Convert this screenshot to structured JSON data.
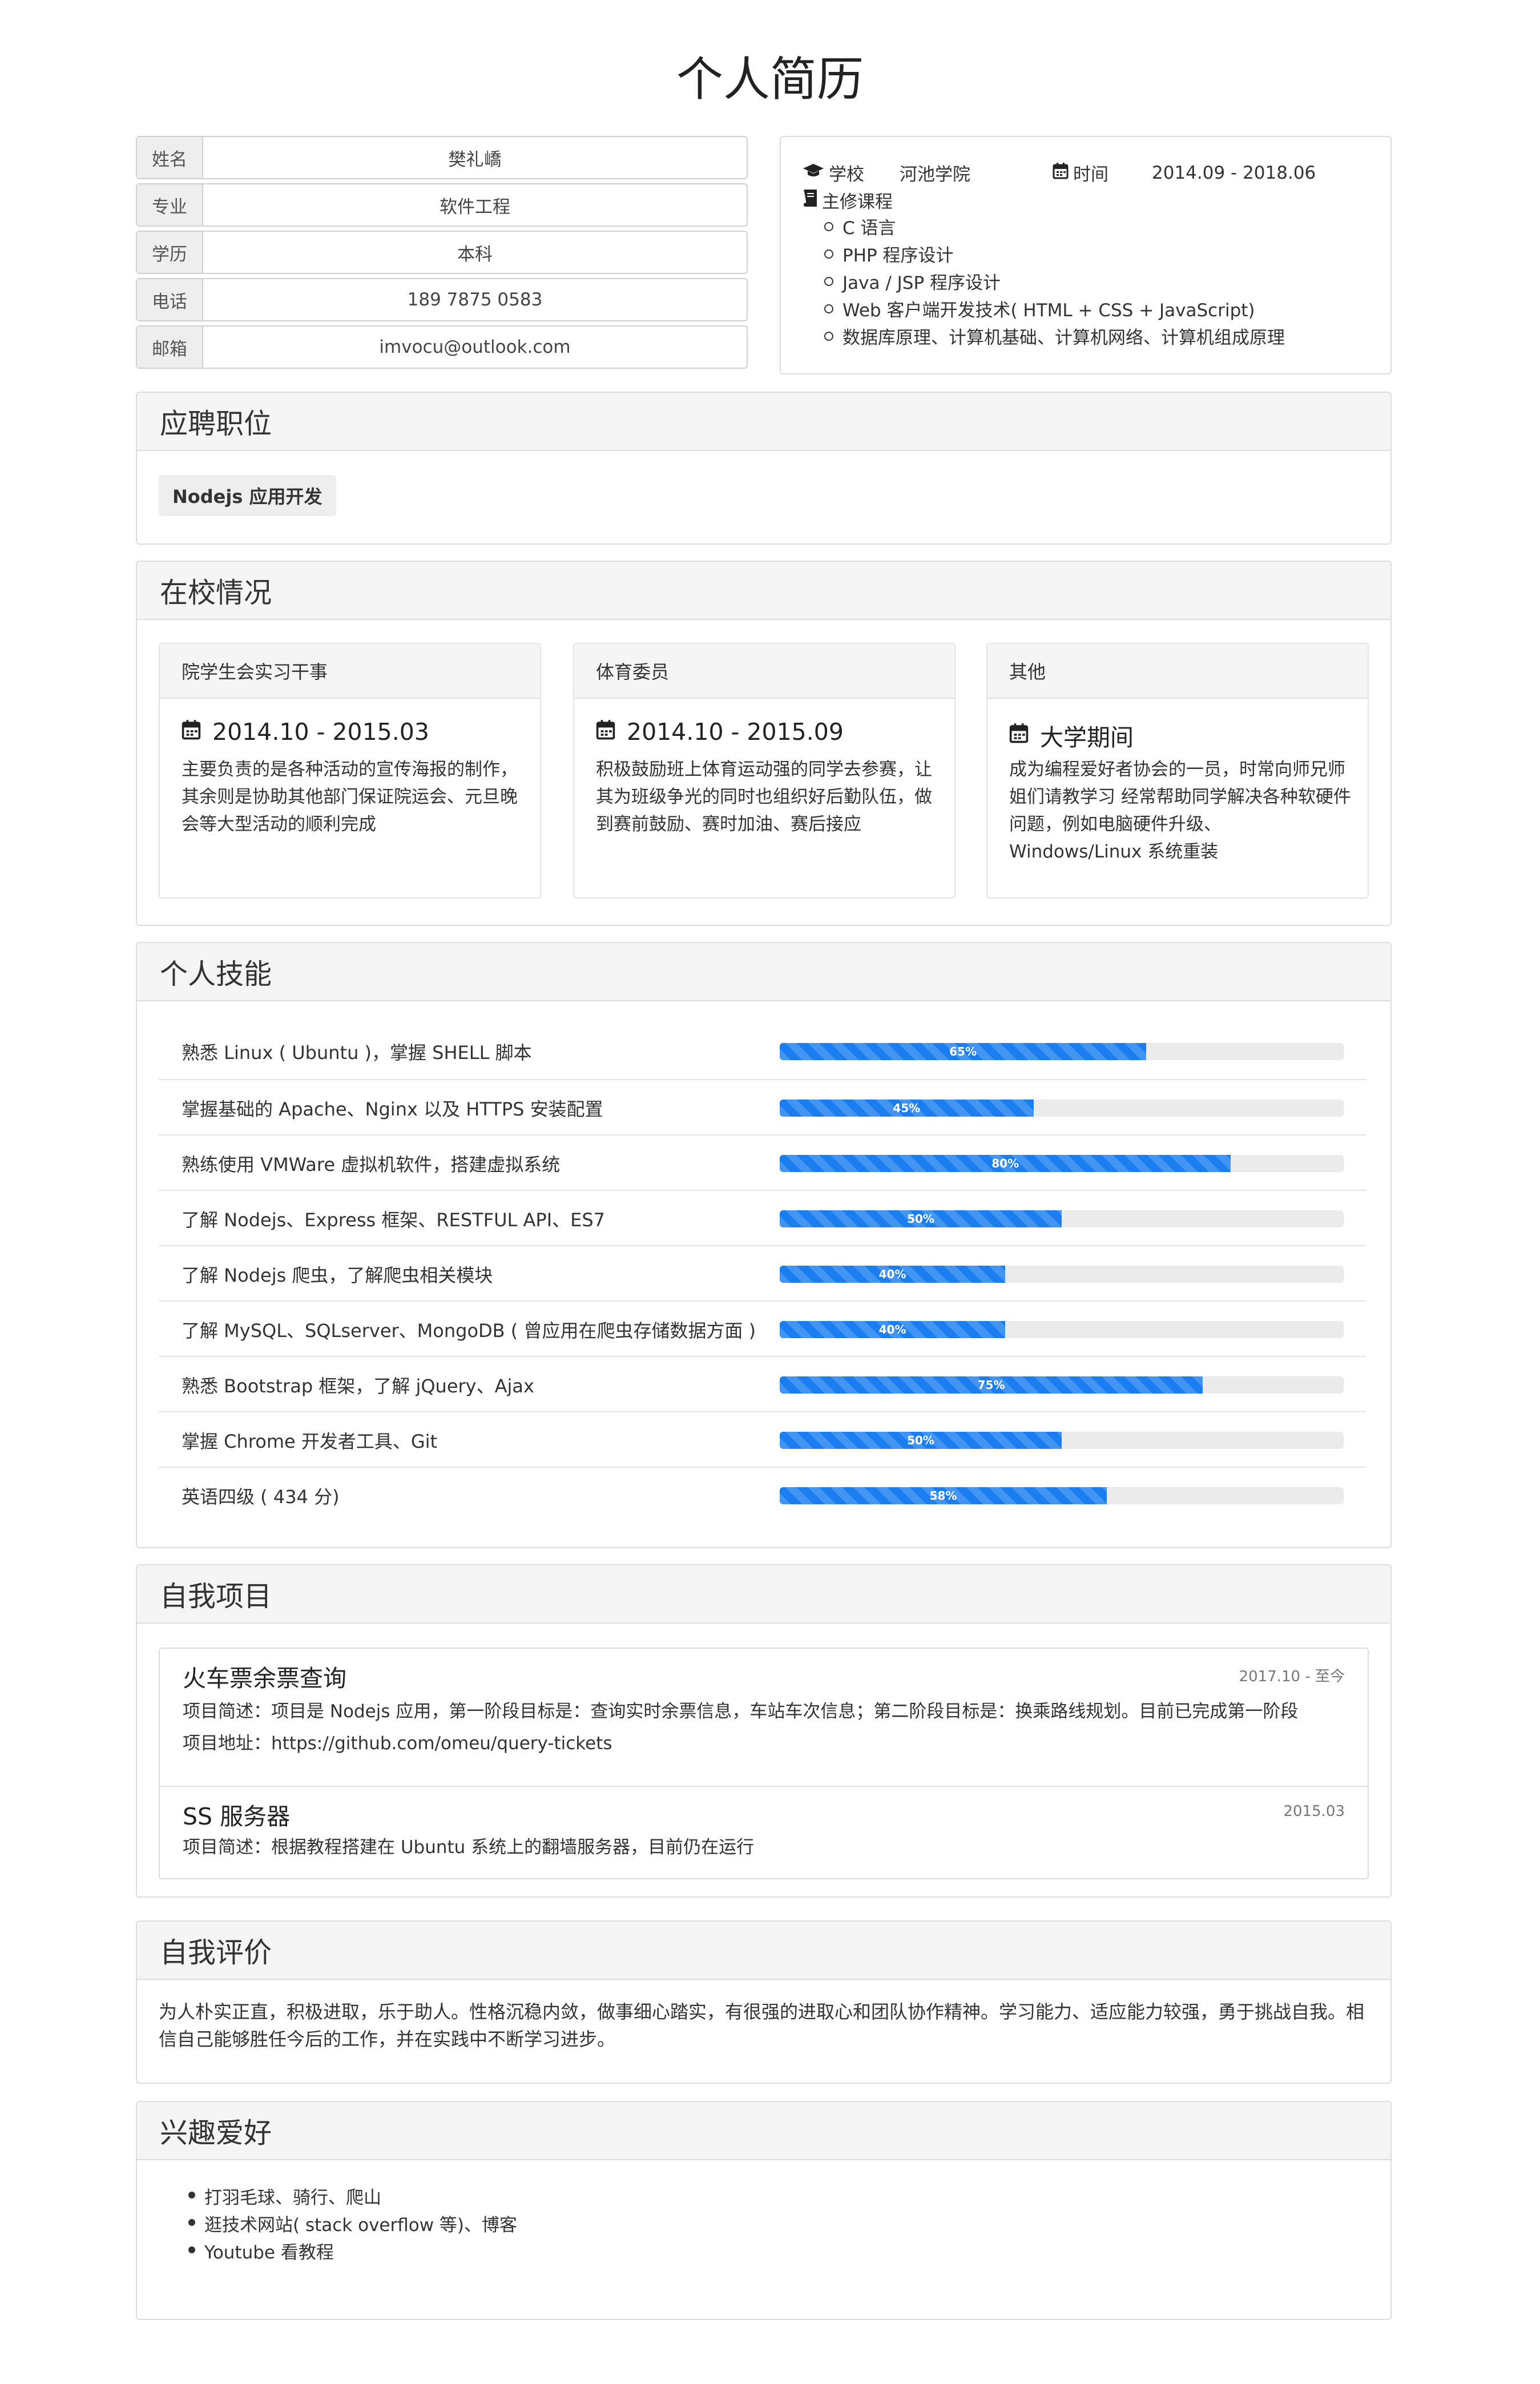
{
  "title": "个人简历",
  "info": {
    "name_label": "姓名",
    "name": "樊礼嶠",
    "major_label": "专业",
    "major": "软件工程",
    "degree_label": "学历",
    "degree": "本科",
    "phone_label": "电话",
    "phone": "189 7875 0583",
    "email_label": "邮箱",
    "email": "imvocu@outlook.com"
  },
  "education": {
    "school_label": "学校",
    "school": "河池学院",
    "time_label": "时间",
    "time": "2014.09 - 2018.06",
    "courses_label": "主修课程",
    "courses": [
      "C 语言",
      "PHP 程序设计",
      "Java / JSP 程序设计",
      "Web 客户端开发技术( HTML + CSS + JavaScript)",
      "数据库原理、计算机基础、计算机网络、计算机组成原理"
    ]
  },
  "position": {
    "heading": "应聘职位",
    "tag": "Nodejs 应用开发"
  },
  "campus": {
    "heading": "在校情况",
    "cards": [
      {
        "title": "院学生会实习干事",
        "date": "2014.10 - 2015.03",
        "text": "主要负责的是各种活动的宣传海报的制作，其余则是协助其他部门保证院运会、元旦晚会等大型活动的顺利完成"
      },
      {
        "title": "体育委员",
        "date": "2014.10 - 2015.09",
        "text": "积极鼓励班上体育运动强的同学去参赛，让其为班级争光的同时也组织好后勤队伍，做到赛前鼓励、赛时加油、赛后接应"
      },
      {
        "title": "其他",
        "date": "大学期间",
        "text": "成为编程爱好者协会的一员，时常向师兄师姐们请教学习 经常帮助同学解决各种软硬件问题，例如电脑硬件升级、Windows/Linux 系统重装"
      }
    ]
  },
  "skills": {
    "heading": "个人技能",
    "items": [
      {
        "label": "熟悉 Linux ( Ubuntu )，掌握 SHELL 脚本",
        "percent": 65,
        "text": "65%"
      },
      {
        "label": "掌握基础的 Apache、Nginx 以及 HTTPS 安装配置",
        "percent": 45,
        "text": "45%"
      },
      {
        "label": "熟练使用 VMWare 虚拟机软件，搭建虚拟系统",
        "percent": 80,
        "text": "80%"
      },
      {
        "label": "了解 Nodejs、Express 框架、RESTFUL API、ES7",
        "percent": 50,
        "text": "50%"
      },
      {
        "label": "了解 Nodejs 爬虫，了解爬虫相关模块",
        "percent": 40,
        "text": "40%"
      },
      {
        "label": "了解 MySQL、SQLserver、MongoDB ( 曾应用在爬虫存储数据方面 )",
        "percent": 40,
        "text": "40%"
      },
      {
        "label": "熟悉 Bootstrap 框架，了解 jQuery、Ajax",
        "percent": 75,
        "text": "75%"
      },
      {
        "label": "掌握 Chrome 开发者工具、Git",
        "percent": 50,
        "text": "50%"
      },
      {
        "label": "英语四级 ( 434 分)",
        "percent": 58,
        "text": "58%"
      }
    ]
  },
  "projects": {
    "heading": "自我项目",
    "items": [
      {
        "title": "火车票余票查询",
        "date": "2017.10 - 至今",
        "desc": "项目简述：项目是 Nodejs 应用，第一阶段目标是：查询实时余票信息，车站车次信息；第二阶段目标是：换乘路线规划。目前已完成第一阶段",
        "url": "项目地址：https://github.com/omeu/query-tickets"
      },
      {
        "title": "SS 服务器",
        "date": "2015.03",
        "desc": "项目简述：根据教程搭建在 Ubuntu 系统上的翻墙服务器，目前仍在运行"
      }
    ]
  },
  "evaluation": {
    "heading": "自我评价",
    "text": "为人朴实正直，积极进取，乐于助人。性格沉稳内敛，做事细心踏实，有很强的进取心和团队协作精神。学习能力、适应能力较强，勇于挑战自我。相信自己能够胜任今后的工作，并在实践中不断学习进步。"
  },
  "hobbies": {
    "heading": "兴趣爱好",
    "items": [
      "打羽毛球、骑行、爬山",
      "逛技术网站( stack overflow 等)、博客",
      "Youtube 看教程"
    ]
  }
}
